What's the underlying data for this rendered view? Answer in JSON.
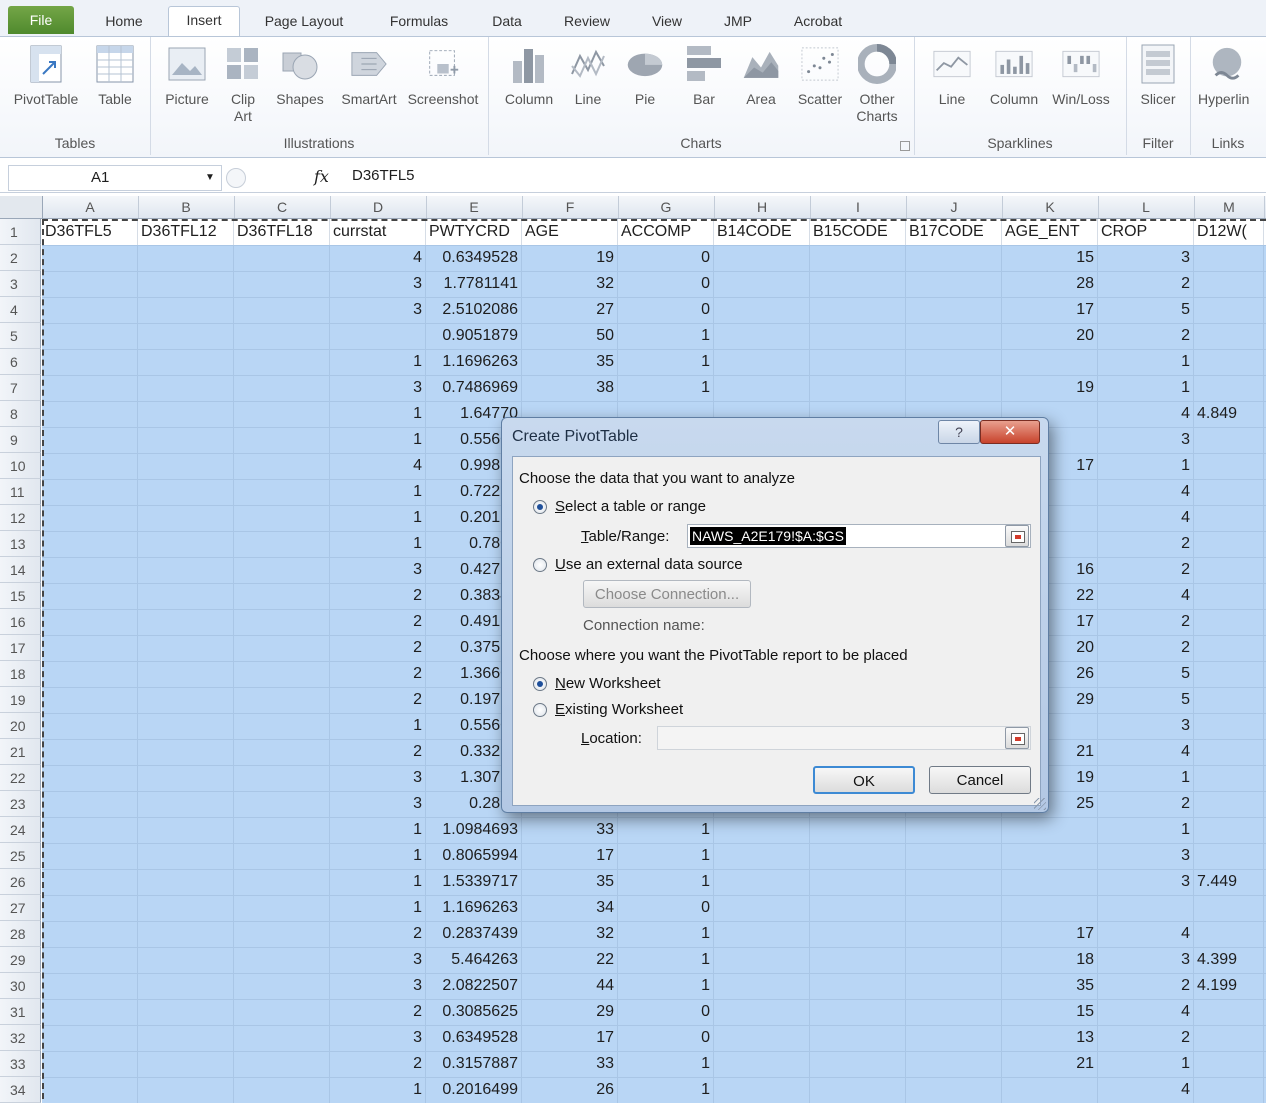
{
  "tabs": [
    "File",
    "Home",
    "Insert",
    "Page Layout",
    "Formulas",
    "Data",
    "Review",
    "View",
    "JMP",
    "Acrobat"
  ],
  "active_tab": "Insert",
  "ribbon": {
    "groups": [
      {
        "label": "Tables",
        "buttons": [
          {
            "label": "PivotTable",
            "icon": "pivottable-icon"
          },
          {
            "label": "Table",
            "icon": "table-icon"
          }
        ]
      },
      {
        "label": "Illustrations",
        "buttons": [
          {
            "label": "Picture",
            "icon": "picture-icon"
          },
          {
            "label": "Clip\nArt",
            "icon": "clipart-icon"
          },
          {
            "label": "Shapes",
            "icon": "shapes-icon"
          },
          {
            "label": "SmartArt",
            "icon": "smartart-icon"
          },
          {
            "label": "Screenshot",
            "icon": "screenshot-icon"
          }
        ]
      },
      {
        "label": "Charts",
        "buttons": [
          {
            "label": "Column",
            "icon": "column-chart-icon"
          },
          {
            "label": "Line",
            "icon": "line-chart-icon"
          },
          {
            "label": "Pie",
            "icon": "pie-chart-icon"
          },
          {
            "label": "Bar",
            "icon": "bar-chart-icon"
          },
          {
            "label": "Area",
            "icon": "area-chart-icon"
          },
          {
            "label": "Scatter",
            "icon": "scatter-chart-icon"
          },
          {
            "label": "Other\nCharts",
            "icon": "other-charts-icon"
          }
        ]
      },
      {
        "label": "Sparklines",
        "buttons": [
          {
            "label": "Line",
            "icon": "sparkline-line-icon"
          },
          {
            "label": "Column",
            "icon": "sparkline-column-icon"
          },
          {
            "label": "Win/Loss",
            "icon": "sparkline-winloss-icon"
          }
        ]
      },
      {
        "label": "Filter",
        "buttons": [
          {
            "label": "Slicer",
            "icon": "slicer-icon"
          }
        ]
      },
      {
        "label": "Links",
        "buttons": [
          {
            "label": "Hyperlin",
            "icon": "hyperlink-icon"
          }
        ]
      }
    ]
  },
  "formula_bar": {
    "name_box": "A1",
    "fx": "fx",
    "value": "D36TFL5"
  },
  "columns": [
    "A",
    "B",
    "C",
    "D",
    "E",
    "F",
    "G",
    "H",
    "I",
    "J",
    "K",
    "L",
    "M"
  ],
  "headers": [
    "D36TFL5",
    "D36TFL12",
    "D36TFL18",
    "currstat",
    "PWTYCRD",
    "AGE",
    "ACCOMP",
    "B14CODE",
    "B15CODE",
    "B17CODE",
    "AGE_ENT",
    "CROP",
    "D12W("
  ],
  "rows": [
    {
      "n": "2",
      "D": "4",
      "E": "0.6349528",
      "F": "19",
      "G": "0",
      "K": "15",
      "L": "3",
      "M": ""
    },
    {
      "n": "3",
      "D": "3",
      "E": "1.7781141",
      "F": "32",
      "G": "0",
      "K": "28",
      "L": "2",
      "M": ""
    },
    {
      "n": "4",
      "D": "3",
      "E": "2.5102086",
      "F": "27",
      "G": "0",
      "K": "17",
      "L": "5",
      "M": ""
    },
    {
      "n": "5",
      "D": "",
      "E": "0.9051879",
      "F": "50",
      "G": "1",
      "K": "20",
      "L": "2",
      "M": ""
    },
    {
      "n": "6",
      "D": "1",
      "E": "1.1696263",
      "F": "35",
      "G": "1",
      "K": "",
      "L": "1",
      "M": ""
    },
    {
      "n": "7",
      "D": "3",
      "E": "0.7486969",
      "F": "38",
      "G": "1",
      "K": "19",
      "L": "1",
      "M": ""
    },
    {
      "n": "8",
      "D": "1",
      "E": "1.64770",
      "F": "",
      "G": "",
      "K": "",
      "L": "4",
      "M": "4.849"
    },
    {
      "n": "9",
      "D": "1",
      "E": "0.55606",
      "F": "",
      "G": "",
      "K": "",
      "L": "3",
      "M": ""
    },
    {
      "n": "10",
      "D": "4",
      "E": "0.99826",
      "F": "",
      "G": "",
      "K": "17",
      "L": "1",
      "M": ""
    },
    {
      "n": "11",
      "D": "1",
      "E": "0.72259",
      "F": "",
      "G": "",
      "K": "",
      "L": "4",
      "M": ""
    },
    {
      "n": "12",
      "D": "1",
      "E": "0.20164",
      "F": "",
      "G": "",
      "K": "",
      "L": "4",
      "M": ""
    },
    {
      "n": "13",
      "D": "1",
      "E": "0.7808",
      "F": "",
      "G": "",
      "K": "",
      "L": "2",
      "M": ""
    },
    {
      "n": "14",
      "D": "3",
      "E": "0.42779",
      "F": "",
      "G": "",
      "K": "16",
      "L": "2",
      "M": ""
    },
    {
      "n": "15",
      "D": "2",
      "E": "0.38349",
      "F": "",
      "G": "",
      "K": "22",
      "L": "4",
      "M": ""
    },
    {
      "n": "16",
      "D": "2",
      "E": "0.49199",
      "F": "",
      "G": "",
      "K": "17",
      "L": "2",
      "M": ""
    },
    {
      "n": "17",
      "D": "2",
      "E": "0.37594",
      "F": "",
      "G": "",
      "K": "20",
      "L": "2",
      "M": ""
    },
    {
      "n": "18",
      "D": "2",
      "E": "1.36606",
      "F": "",
      "G": "",
      "K": "26",
      "L": "5",
      "M": ""
    },
    {
      "n": "19",
      "D": "2",
      "E": "0.19716",
      "F": "",
      "G": "",
      "K": "29",
      "L": "5",
      "M": ""
    },
    {
      "n": "20",
      "D": "1",
      "E": "0.55606",
      "F": "",
      "G": "",
      "K": "",
      "L": "3",
      "M": ""
    },
    {
      "n": "21",
      "D": "2",
      "E": "0.33257",
      "F": "",
      "G": "",
      "K": "21",
      "L": "4",
      "M": ""
    },
    {
      "n": "22",
      "D": "3",
      "E": "1.30760",
      "F": "",
      "G": "",
      "K": "19",
      "L": "1",
      "M": ""
    },
    {
      "n": "23",
      "D": "3",
      "E": "0.2891",
      "F": "",
      "G": "",
      "K": "25",
      "L": "2",
      "M": ""
    },
    {
      "n": "24",
      "D": "1",
      "E": "1.0984693",
      "F": "33",
      "G": "1",
      "K": "",
      "L": "1",
      "M": ""
    },
    {
      "n": "25",
      "D": "1",
      "E": "0.8065994",
      "F": "17",
      "G": "1",
      "K": "",
      "L": "3",
      "M": ""
    },
    {
      "n": "26",
      "D": "1",
      "E": "1.5339717",
      "F": "35",
      "G": "1",
      "K": "",
      "L": "3",
      "M": "7.449"
    },
    {
      "n": "27",
      "D": "1",
      "E": "1.1696263",
      "F": "34",
      "G": "0",
      "K": "",
      "L": "",
      "M": ""
    },
    {
      "n": "28",
      "D": "2",
      "E": "0.2837439",
      "F": "32",
      "G": "1",
      "K": "17",
      "L": "4",
      "M": ""
    },
    {
      "n": "29",
      "D": "3",
      "E": "5.464263",
      "F": "22",
      "G": "1",
      "K": "18",
      "L": "3",
      "M": "4.399"
    },
    {
      "n": "30",
      "D": "3",
      "E": "2.0822507",
      "F": "44",
      "G": "1",
      "K": "35",
      "L": "2",
      "M": "4.199"
    },
    {
      "n": "31",
      "D": "2",
      "E": "0.3085625",
      "F": "29",
      "G": "0",
      "K": "15",
      "L": "4",
      "M": ""
    },
    {
      "n": "32",
      "D": "3",
      "E": "0.6349528",
      "F": "17",
      "G": "0",
      "K": "13",
      "L": "2",
      "M": ""
    },
    {
      "n": "33",
      "D": "2",
      "E": "0.3157887",
      "F": "33",
      "G": "1",
      "K": "21",
      "L": "1",
      "M": ""
    },
    {
      "n": "34",
      "D": "1",
      "E": "0.2016499",
      "F": "26",
      "G": "1",
      "K": "",
      "L": "4",
      "M": ""
    }
  ],
  "dialog": {
    "title": "Create PivotTable",
    "help": "?",
    "close": "✕",
    "section1": "Choose the data that you want to analyze",
    "opt_select_range": "elect a table or range",
    "opt_select_range_key": "S",
    "table_range_label_key": "T",
    "table_range_label": "able/Range:",
    "table_range_value": "NAWS_A2E179!$A:$GS",
    "opt_external_key": "U",
    "opt_external": "se an external data source",
    "choose_connection": "Choose Connection...",
    "connection_name": "Connection name:",
    "section2": "Choose where you want the PivotTable report to be placed",
    "opt_new_key": "N",
    "opt_new": "ew Worksheet",
    "opt_existing_key": "E",
    "opt_existing": "xisting Worksheet",
    "location_key": "L",
    "location_label": "ocation:",
    "ok": "OK",
    "cancel": "Cancel"
  }
}
